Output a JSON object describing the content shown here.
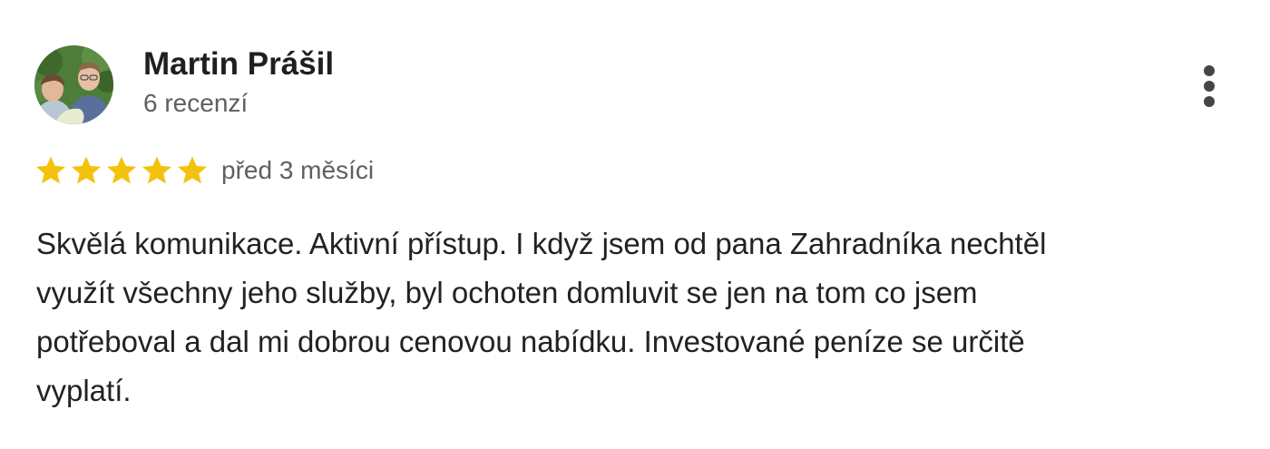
{
  "review": {
    "author_name": "Martin Prášil",
    "review_count": "6 recenzí",
    "rating": 5,
    "rating_max": 5,
    "date": "před 3 měsíci",
    "text_lines": [
      "Skvělá komunikace. Aktivní přístup. I když jsem od pana Zahradníka nechtěl",
      "využít všechny jeho služby, byl ochoten domluvit se jen na tom co jsem",
      "potřeboval a dal mi dobrou cenovou nabídku. Investované peníze se určitě",
      "vyplatí."
    ]
  },
  "icons": {
    "avatar": "avatar-photo",
    "star": "star-icon",
    "menu": "more-vert-icon"
  },
  "colors": {
    "star": "#F4C20D",
    "name": "#1f1f1f",
    "secondary": "#5f5f5f",
    "text": "#222222",
    "menu": "#454545"
  }
}
